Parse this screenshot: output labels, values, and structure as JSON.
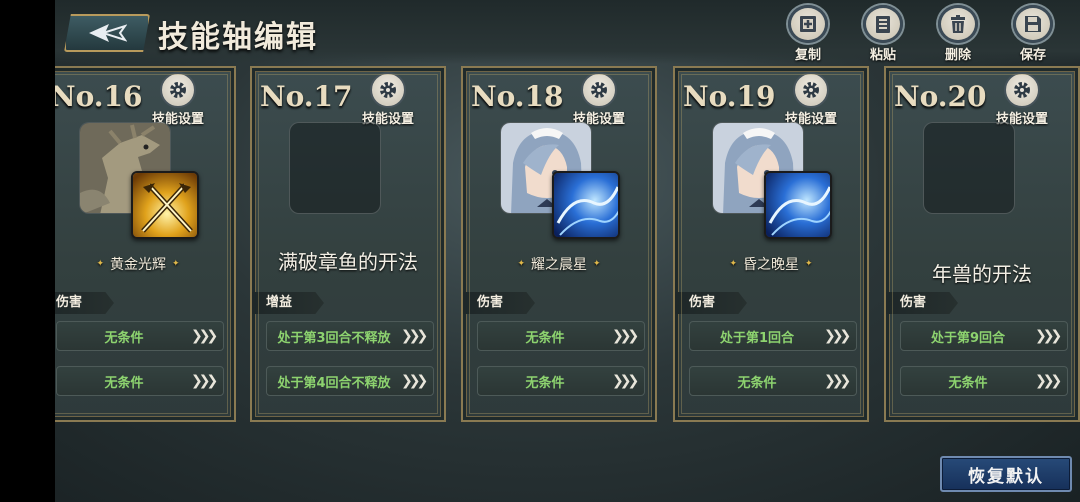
{
  "header": {
    "title": "技能轴编辑",
    "tools": [
      {
        "label": "复制",
        "icon": "copy-icon"
      },
      {
        "label": "粘贴",
        "icon": "paste-icon"
      },
      {
        "label": "删除",
        "icon": "trash-icon"
      },
      {
        "label": "保存",
        "icon": "save-icon"
      }
    ]
  },
  "cards": [
    {
      "no": "No.16",
      "settings_label": "技能设置",
      "portrait": "dragon-character",
      "skill_icon": "golden-swords-skill",
      "skill_name": "黄金光辉",
      "type": "伤害",
      "conditions": [
        "无条件",
        "无条件"
      ]
    },
    {
      "no": "No.17",
      "settings_label": "技能设置",
      "portrait": "empty",
      "note": "满破章鱼的开法",
      "type": "增益",
      "conditions": [
        "处于第3回合不释放",
        "处于第4回合不释放"
      ]
    },
    {
      "no": "No.18",
      "settings_label": "技能设置",
      "portrait": "silver-haired-maid-character",
      "skill_icon": "blue-wave-skill",
      "skill_name": "耀之晨星",
      "type": "伤害",
      "conditions": [
        "无条件",
        "无条件"
      ]
    },
    {
      "no": "No.19",
      "settings_label": "技能设置",
      "portrait": "silver-haired-maid-character",
      "skill_icon": "blue-wave-skill",
      "skill_name": "昏之晚星",
      "type": "伤害",
      "conditions": [
        "处于第1回合",
        "无条件"
      ]
    },
    {
      "no": "No.20",
      "settings_label": "技能设置",
      "portrait": "empty",
      "note": "年兽的开法",
      "type": "伤害",
      "conditions": [
        "处于第9回合",
        "无条件"
      ]
    }
  ],
  "footer": {
    "restore_label": "恢复默认"
  },
  "colors": {
    "condition_text": "#8dd36f",
    "card_border": "#8a7a52",
    "restore_button": "#1f3d6a",
    "skill_name_spark": "#e0b84a"
  }
}
